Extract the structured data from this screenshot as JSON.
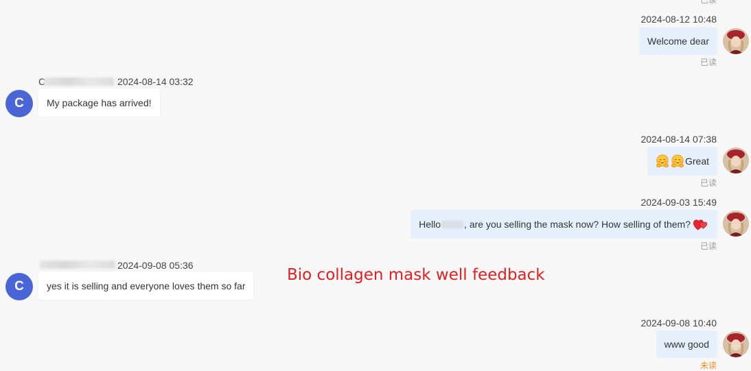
{
  "top_status": "已读",
  "messages": [
    {
      "side": "out",
      "timestamp": "2024-08-12 10:48",
      "text": "Welcome dear",
      "status": "已读"
    },
    {
      "side": "in",
      "avatar_letter": "C",
      "name_visible": "C",
      "timestamp": "2024-08-14 03:32",
      "text": "My package has arrived!"
    },
    {
      "side": "out",
      "timestamp": "2024-08-14 07:38",
      "text": "Great",
      "emoji_prefix": [
        "hugging-face-emoji",
        "hugging-face-emoji"
      ],
      "status": "已读"
    },
    {
      "side": "out",
      "timestamp": "2024-09-03 15:49",
      "text_before": "Hello",
      "text_after": ", are you selling the mask now? How selling of them?",
      "emoji_suffix": "two-hearts-emoji",
      "status": "已读"
    },
    {
      "side": "in",
      "avatar_letter": "C",
      "name_visible": "",
      "timestamp": "2024-09-08 05:36",
      "text": "yes it is selling and everyone loves them so far"
    },
    {
      "side": "out",
      "timestamp": "2024-09-08 10:40",
      "text": "www good",
      "status": "未读"
    }
  ],
  "caption": "Bio collagen mask well feedback",
  "colors": {
    "background": "#f7f7f8",
    "outgoing_bubble": "#e6f0fd",
    "incoming_bubble": "#ffffff",
    "customer_avatar": "#4a66d6",
    "unread_status": "#f08c1d",
    "caption": "#e02020"
  }
}
